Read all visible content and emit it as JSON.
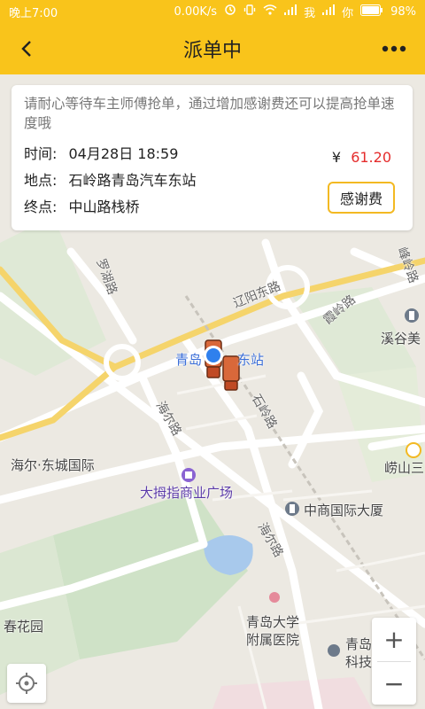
{
  "status_bar": {
    "time": "晚上7:00",
    "network_speed": "0.00K/s",
    "carrier_1": "我",
    "carrier_2": "你",
    "battery": "98%"
  },
  "header": {
    "title": "派单中"
  },
  "order_card": {
    "notice": "请耐心等待车主师傅抢单，通过增加感谢费还可以提高抢单速度哦",
    "time_label": "时间:",
    "time_value": "04月28日 18:59",
    "origin_label": "地点:",
    "origin_value": "石岭路青岛汽车东站",
    "dest_label": "终点:",
    "dest_value": "中山路栈桥",
    "price_symbol": "¥",
    "price_value": "61.20",
    "thanks_button": "感谢费"
  },
  "map": {
    "labels": {
      "luohu_road": "罗湖路",
      "liaoyang_east_road": "辽阳东路",
      "xiadian_road": "霞岭路",
      "fengling_road": "峰岭路",
      "xigu": "溪谷美",
      "station_a": "青岛",
      "station_b": "东站",
      "haier_road_1": "海尔路",
      "shiling_road": "石岭路",
      "haier_dongcheng": "海尔·东城国际",
      "damuzhi": "大拇指商业广场",
      "laoshan": "崂山三",
      "zhongshang": "中商国际大厦",
      "haier_road_2": "海尔路",
      "chunhua": "春花园",
      "hospital_1": "青岛大学",
      "hospital_2": "附属医院",
      "keji_1": "青岛",
      "keji_2": "科技"
    }
  },
  "zoom": {
    "plus": "+",
    "minus": "−"
  },
  "colors": {
    "brand_yellow": "#f9c41b",
    "price_red": "#e52c2c",
    "location_blue": "#2f80ed"
  }
}
